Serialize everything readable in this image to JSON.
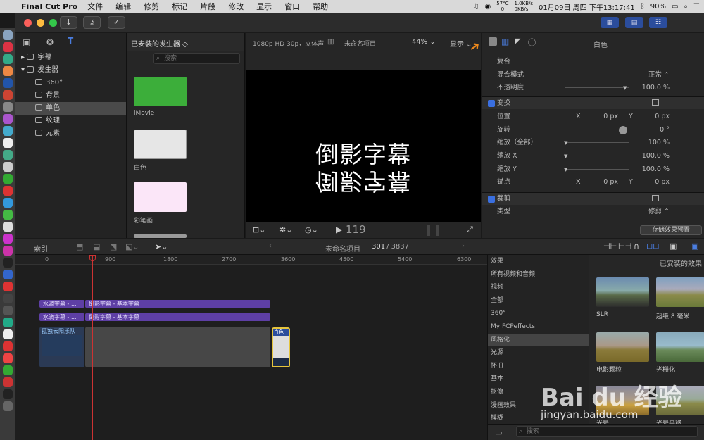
{
  "menubar": {
    "app": "Final Cut Pro",
    "items": [
      "文件",
      "编辑",
      "修剪",
      "标记",
      "片段",
      "修改",
      "显示",
      "窗口",
      "帮助"
    ],
    "temp": "57°C",
    "rpm": "0",
    "net_up": "1.0KB/s",
    "net_down": "0KB/s",
    "datetime": "01月09日 周四 下午13:17:41",
    "battery": "90%"
  },
  "library": {
    "header_selector": "已安装的发生器",
    "items": [
      {
        "label": "字幕",
        "level": 0
      },
      {
        "label": "发生器",
        "level": 0
      },
      {
        "label": "360°",
        "level": 1
      },
      {
        "label": "背景",
        "level": 1
      },
      {
        "label": "单色",
        "level": 1
      },
      {
        "label": "纹理",
        "level": 1
      },
      {
        "label": "元素",
        "level": 1
      }
    ]
  },
  "browser": {
    "search_placeholder": "搜索",
    "items": [
      {
        "label": "iMovie",
        "color": "#3cae3a"
      },
      {
        "label": "白色",
        "color": "#e6e6e6"
      },
      {
        "label": "彩笔画",
        "color": "#fbe6f8"
      }
    ]
  },
  "viewer": {
    "format": "1080p HD 30p，立体声",
    "project": "未命名项目",
    "zoom": "44%",
    "view_label": "显示",
    "text_top": "倒影字幕",
    "text_mirror": "倒影字幕",
    "timecode": "119"
  },
  "inspector": {
    "title": "白色",
    "rows": [
      {
        "label": "复合",
        "value": "",
        "type": "section"
      },
      {
        "label": "混合模式",
        "value": "正常 ⌃",
        "type": "row"
      },
      {
        "label": "不透明度",
        "value": "100.0 %",
        "type": "slider"
      },
      {
        "label": "变换",
        "value": "",
        "type": "check"
      },
      {
        "label": "位置",
        "x": "0 px",
        "y": "0 px",
        "type": "xy"
      },
      {
        "label": "旋转",
        "value": "0 °",
        "type": "dial"
      },
      {
        "label": "缩放（全部）",
        "value": "100 %",
        "type": "slider"
      },
      {
        "label": "缩放 X",
        "value": "100.0 %",
        "type": "slider"
      },
      {
        "label": "缩放 Y",
        "value": "100.0 %",
        "type": "slider"
      },
      {
        "label": "锚点",
        "x": "0 px",
        "y": "0 px",
        "type": "xy"
      },
      {
        "label": "裁剪",
        "value": "",
        "type": "check"
      },
      {
        "label": "类型",
        "value": "修剪 ⌃",
        "type": "row"
      }
    ],
    "save_button": "存储效果预置"
  },
  "timeline_bar": {
    "index_label": "索引",
    "project": "未命名项目",
    "position": "301",
    "duration": "/ 3837"
  },
  "ruler": [
    "0",
    "900",
    "1800",
    "2700",
    "3600",
    "4500",
    "5400",
    "6300"
  ],
  "clips": {
    "row1_left": "水滴字幕 - ...",
    "row1_right": "倒影字幕 - 基本字幕",
    "row2_left": "水滴字幕 - ...",
    "row2_right": "倒影字幕 - 基本字幕",
    "video": "孤独云阳乐队",
    "white": "白色"
  },
  "effects": {
    "title": "效果",
    "categories": [
      "所有视频和音频",
      "视频",
      "全部",
      "360°",
      "My FCPeffects",
      "风格化",
      "光源",
      "怀旧",
      "基本",
      "抠像",
      "漫画效果",
      "模糊"
    ],
    "selected": "风格化",
    "installed_title": "已安装的效果",
    "thumbs": [
      {
        "label": "SLR"
      },
      {
        "label": "超级 8 毫米"
      },
      {
        "label": "电影颗粒"
      },
      {
        "label": "光栅化"
      },
      {
        "label": "光晕"
      },
      {
        "label": "光晕平移"
      }
    ],
    "search_placeholder": "搜索"
  },
  "watermark": {
    "brand": "Bai du 经验",
    "url": "jingyan.baidu.com"
  }
}
